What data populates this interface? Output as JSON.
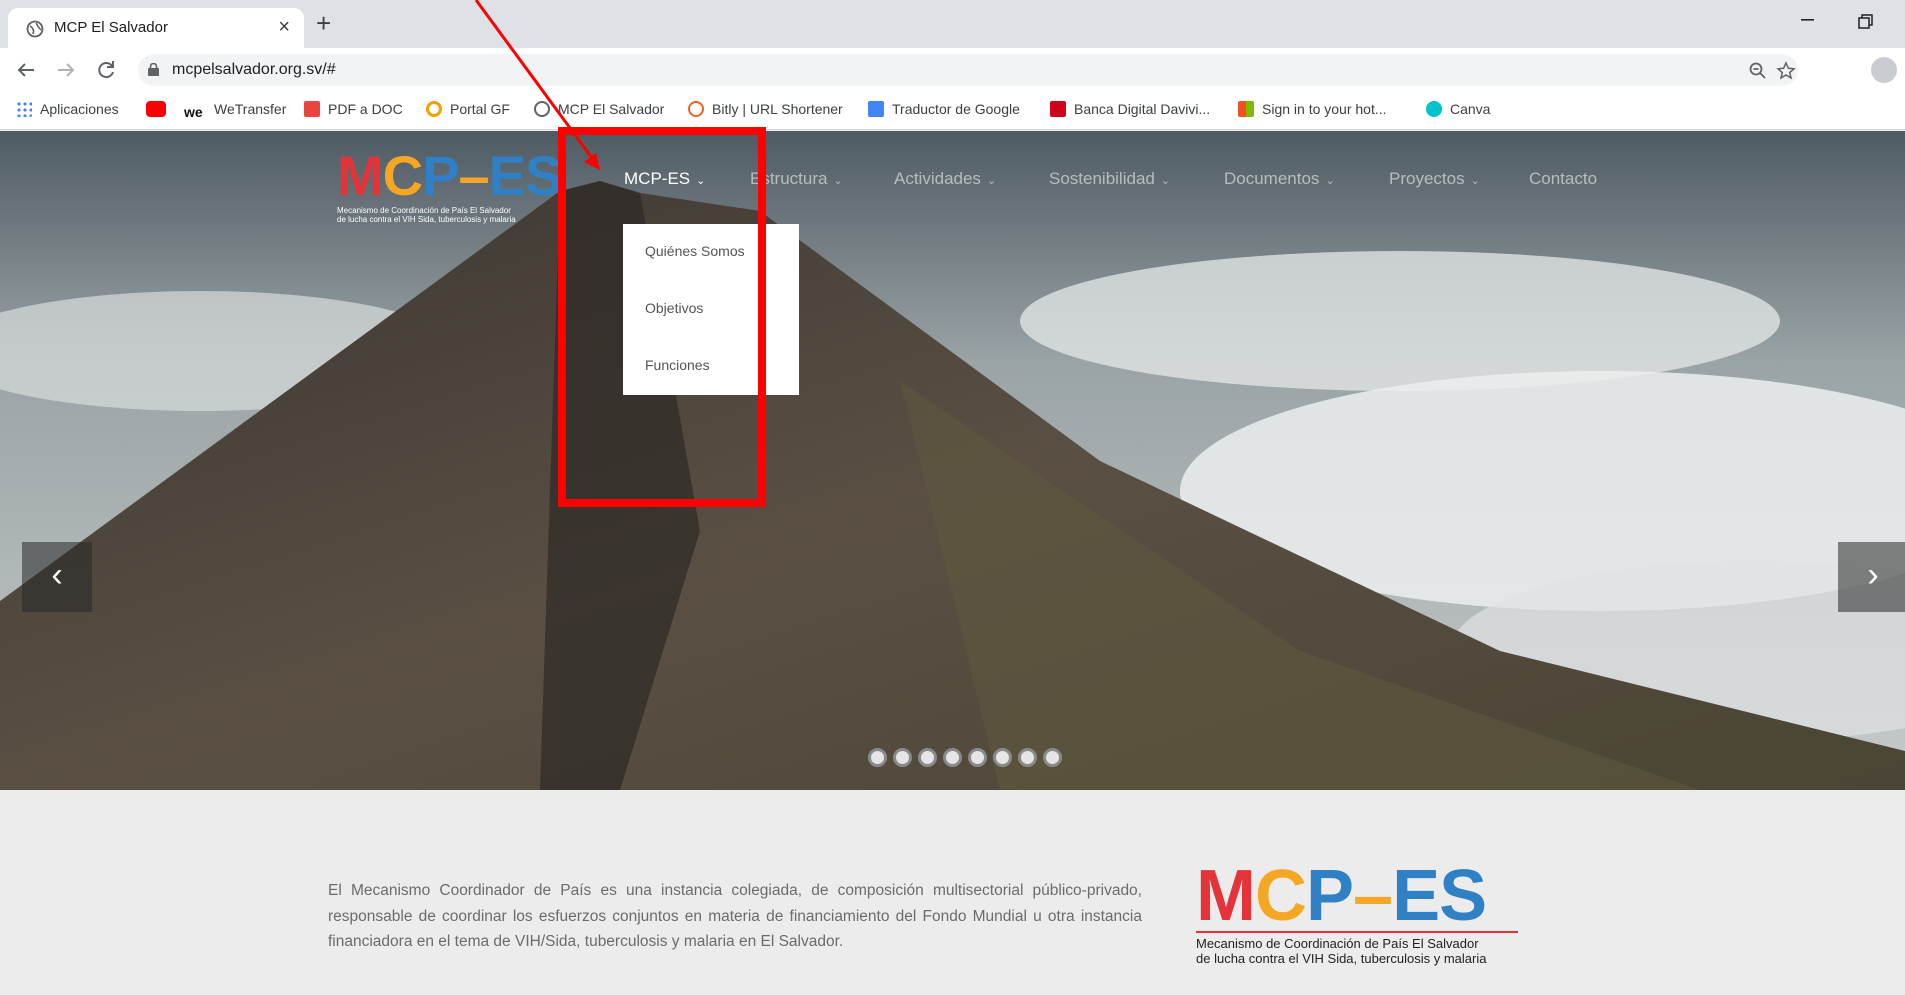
{
  "browser": {
    "tab_title": "MCP El Salvador",
    "tab_close": "×",
    "new_tab": "+",
    "url": "mcpelsalvador.org.sv/#",
    "bookmarks": [
      {
        "label": "Aplicaciones",
        "color": "#4285f4"
      },
      {
        "label": "",
        "color": "#ff0000"
      },
      {
        "label": "WeTransfer",
        "color": "#111111"
      },
      {
        "label": "PDF a DOC",
        "color": "#e8453c"
      },
      {
        "label": "Portal GF",
        "color": "#f4a100"
      },
      {
        "label": "MCP El Salvador",
        "color": "#5f6368"
      },
      {
        "label": "Bitly | URL Shortener",
        "color": "#ee6123"
      },
      {
        "label": "Traductor de Google",
        "color": "#4285f4"
      },
      {
        "label": "Banca Digital Davivi...",
        "color": "#d0021b"
      },
      {
        "label": "Sign in to your hot...",
        "color": "#f25022"
      },
      {
        "label": "Canva",
        "color": "#00c4cc"
      }
    ]
  },
  "site": {
    "logo": {
      "letters": [
        "M",
        "C",
        "P",
        "–",
        "ES"
      ],
      "letter_colors": [
        "#e5333a",
        "#f5a623",
        "#2f80c4",
        "#f5a623",
        "#2f80c4"
      ],
      "subtitle_line1": "Mecanismo de Coordinación de País El Salvador",
      "subtitle_line2": "de lucha contra el VIH Sida, tuberculosis y malaria"
    },
    "menu": [
      {
        "label": "MCP-ES",
        "active": true
      },
      {
        "label": "Estructura"
      },
      {
        "label": "Actividades"
      },
      {
        "label": "Sostenibilidad"
      },
      {
        "label": "Documentos"
      },
      {
        "label": "Proyectos"
      },
      {
        "label": "Contacto"
      }
    ],
    "dropdown": [
      "Quiénes Somos",
      "Objetivos",
      "Funciones"
    ],
    "slider": {
      "prev": "‹",
      "next": "›",
      "slide_count": 8
    },
    "intro": "El Mecanismo Coordinador de País es una instancia colegiada, de composición multisectorial público-privado, responsable de coordinar los esfuerzos conjuntos en materia de financiamiento del Fondo Mundial u otra instancia financiadora en el tema de VIH/Sida, tuberculosis y malaria en El Salvador."
  },
  "annotation_color": "#ff0000"
}
